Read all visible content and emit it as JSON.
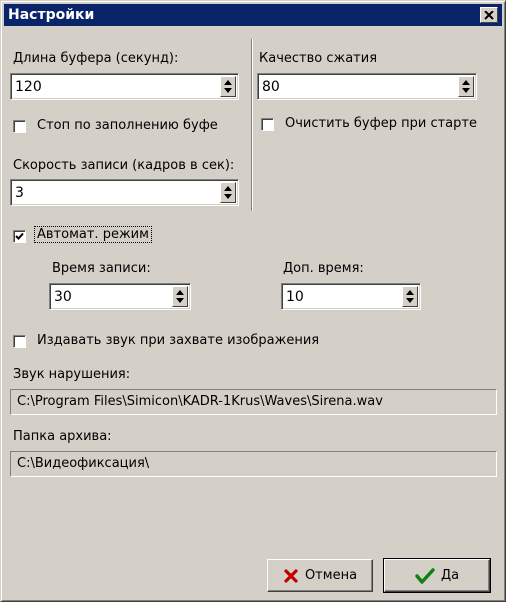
{
  "window": {
    "title": "Настройки"
  },
  "buffer": {
    "label": "Длина буфера (секунд):",
    "value": "120"
  },
  "compression": {
    "label": "Качество сжатия",
    "value": "80"
  },
  "stop_on_full": {
    "label": "Стоп по заполнению буфе",
    "checked": false
  },
  "clear_on_start": {
    "label": "Очистить буфер при старте",
    "checked": false
  },
  "record_speed": {
    "label": "Скорость записи (кадров в сек):",
    "value": "3"
  },
  "auto_mode": {
    "label": "Автомат. режим",
    "checked": true
  },
  "record_time": {
    "label": "Время записи:",
    "value": "30"
  },
  "extra_time": {
    "label": "Доп. время:",
    "value": "10"
  },
  "sound_on_capture": {
    "label": "Издавать звук при захвате изображения",
    "checked": false
  },
  "violation_sound": {
    "label": "Звук нарушения:",
    "value": "C:\\Program Files\\Simicon\\KADR-1Krus\\Waves\\Sirena.wav"
  },
  "archive_folder": {
    "label": "Папка архива:",
    "value": "C:\\Видеофиксация\\"
  },
  "buttons": {
    "cancel": "Отмена",
    "ok": "Да"
  }
}
